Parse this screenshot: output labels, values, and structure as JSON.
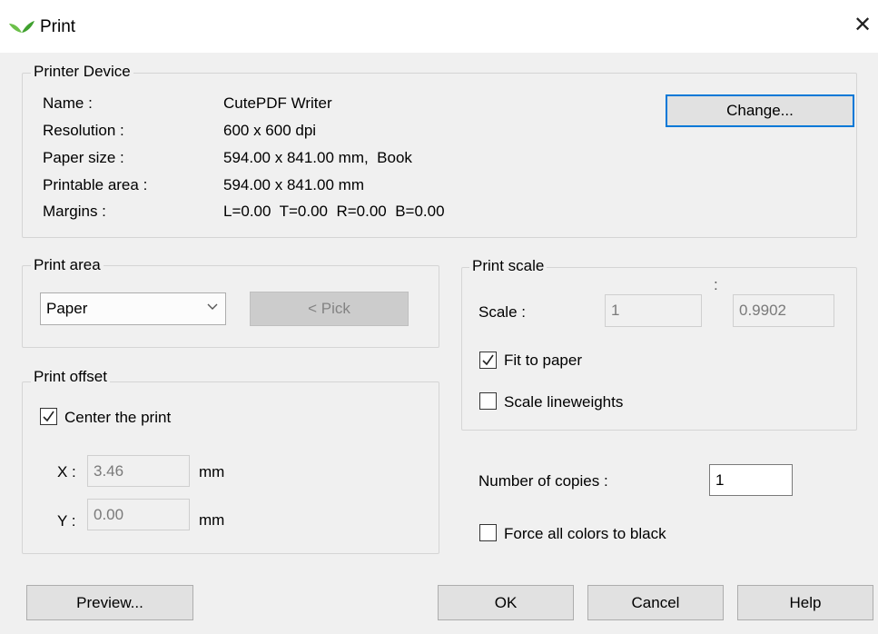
{
  "window": {
    "title": "Print",
    "icon": "leaf-icon",
    "close_glyph": "✕",
    "accent": "#0078d7"
  },
  "printer_device": {
    "legend": "Printer Device",
    "rows": [
      {
        "label": "Name :",
        "value": "CutePDF Writer"
      },
      {
        "label": "Resolution :",
        "value": "600 x 600 dpi"
      },
      {
        "label": "Paper size :",
        "value": "594.00 x 841.00 mm,  Book"
      },
      {
        "label": "Printable area :",
        "value": "594.00 x 841.00 mm"
      },
      {
        "label": "Margins :",
        "value": "L=0.00  T=0.00  R=0.00  B=0.00"
      }
    ],
    "change_label": "Change..."
  },
  "print_area": {
    "legend": "Print area",
    "selected": "Paper",
    "pick_label": "< Pick"
  },
  "print_offset": {
    "legend": "Print offset",
    "center_label": "Center the print",
    "center_checked": true,
    "x_label": "X :",
    "x_value": "3.46",
    "x_unit": "mm",
    "y_label": "Y :",
    "y_value": "0.00",
    "y_unit": "mm"
  },
  "print_scale": {
    "legend": "Print scale",
    "scale_label": "Scale :",
    "scale_value": "1",
    "ratio_colon": ":",
    "ratio_value": "0.9902",
    "fit_label": "Fit to paper",
    "fit_checked": true,
    "lineweights_label": "Scale lineweights",
    "lineweights_checked": false
  },
  "copies": {
    "label": "Number of copies :",
    "value": "1"
  },
  "force_black": {
    "label": "Force all colors to black",
    "checked": false
  },
  "buttons": {
    "preview": "Preview...",
    "ok": "OK",
    "cancel": "Cancel",
    "help": "Help"
  }
}
